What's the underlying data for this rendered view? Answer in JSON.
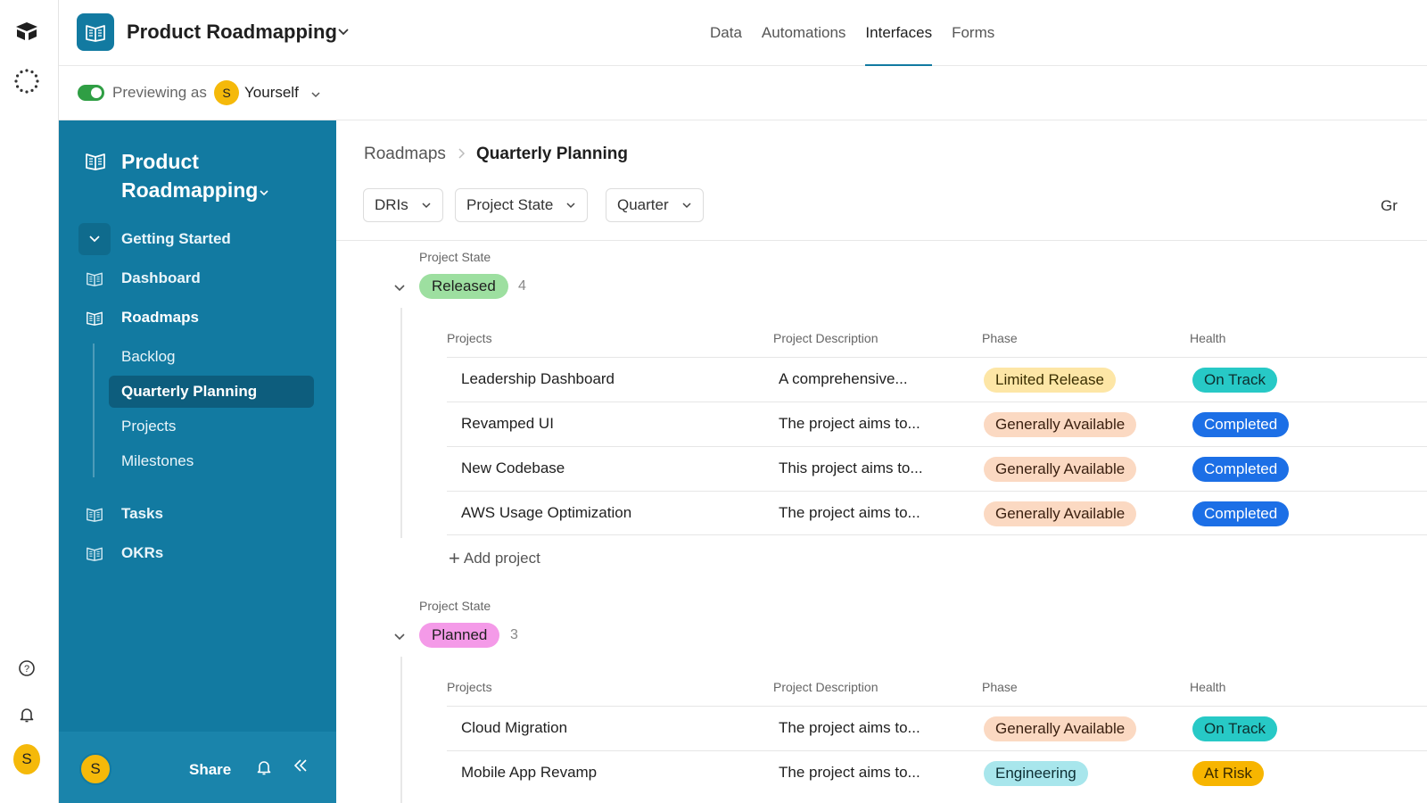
{
  "colors": {
    "brand": "#127aa1",
    "released_pill": "#9ddfa0",
    "planned_pill": "#f49ae8",
    "limited_release": "#fde6a6",
    "generally_available": "#fbd9c2",
    "engineering": "#a8e6ec",
    "on_track": "#27c9c6",
    "completed": "#1c6fe6",
    "at_risk": "#f7b500"
  },
  "topbar": {
    "base_title": "Product Roadmapping",
    "tabs": [
      {
        "label": "Data",
        "active": false
      },
      {
        "label": "Automations",
        "active": false
      },
      {
        "label": "Interfaces",
        "active": true
      },
      {
        "label": "Forms",
        "active": false
      }
    ]
  },
  "preview": {
    "label": "Previewing as",
    "avatar_letter": "S",
    "user": "Yourself"
  },
  "sidebar": {
    "title_line1": "Product",
    "title_line2": "Roadmapping",
    "items": [
      {
        "label": "Getting Started"
      },
      {
        "label": "Dashboard"
      },
      {
        "label": "Roadmaps"
      },
      {
        "label": "Tasks"
      },
      {
        "label": "OKRs"
      }
    ],
    "subitems": [
      {
        "label": "Backlog"
      },
      {
        "label": "Quarterly Planning"
      },
      {
        "label": "Projects"
      },
      {
        "label": "Milestones"
      }
    ],
    "footer": {
      "avatar_letter": "S",
      "share_label": "Share"
    }
  },
  "rail": {
    "avatar_letter": "S"
  },
  "main": {
    "breadcrumb": {
      "parent": "Roadmaps",
      "current": "Quarterly Planning"
    },
    "filters": [
      "DRIs",
      "Project State",
      "Quarter"
    ],
    "group_button_partial": "Gr",
    "groups": [
      {
        "label": "Project State",
        "state": "Released",
        "count": "4",
        "columns": [
          "Projects",
          "Project Description",
          "Phase",
          "Health"
        ],
        "rows": [
          {
            "project": "Leadership Dashboard",
            "description": "A comprehensive...",
            "phase": "Limited Release",
            "health": "On Track"
          },
          {
            "project": "Revamped UI",
            "description": "The project aims to...",
            "phase": "Generally Available",
            "health": "Completed"
          },
          {
            "project": "New Codebase",
            "description": "This project aims to...",
            "phase": "Generally Available",
            "health": "Completed"
          },
          {
            "project": "AWS Usage Optimization",
            "description": "The project aims to...",
            "phase": "Generally Available",
            "health": "Completed"
          }
        ],
        "add_label": "Add project"
      },
      {
        "label": "Project State",
        "state": "Planned",
        "count": "3",
        "columns": [
          "Projects",
          "Project Description",
          "Phase",
          "Health"
        ],
        "rows": [
          {
            "project": "Cloud Migration",
            "description": "The project aims to...",
            "phase": "Generally Available",
            "health": "On Track"
          },
          {
            "project": "Mobile App Revamp",
            "description": "The project aims to...",
            "phase": "Engineering",
            "health": "At Risk"
          }
        ]
      }
    ]
  }
}
